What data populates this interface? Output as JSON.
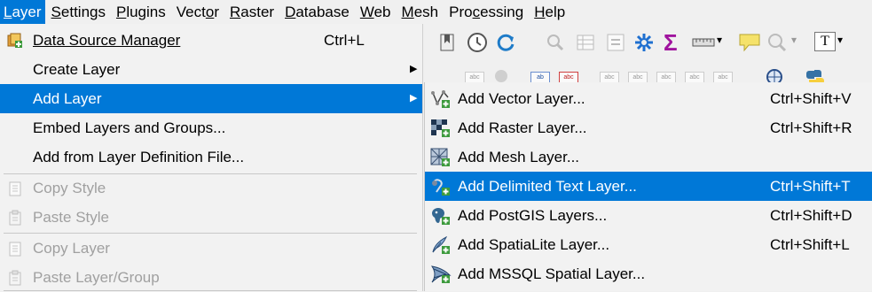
{
  "menubar": {
    "items": [
      {
        "mnemonic": "L",
        "rest": "ayer",
        "active": true
      },
      {
        "mnemonic": "S",
        "rest": "ettings",
        "active": false
      },
      {
        "mnemonic": "P",
        "rest": "lugins",
        "active": false
      },
      {
        "pre": "Vect",
        "mnemonic": "o",
        "rest": "r",
        "active": false
      },
      {
        "mnemonic": "R",
        "rest": "aster",
        "active": false
      },
      {
        "mnemonic": "D",
        "rest": "atabase",
        "active": false
      },
      {
        "mnemonic": "W",
        "rest": "eb",
        "active": false
      },
      {
        "mnemonic": "M",
        "rest": "esh",
        "active": false
      },
      {
        "pre": "Pro",
        "mnemonic": "c",
        "rest": "essing",
        "active": false
      },
      {
        "mnemonic": "H",
        "rest": "elp",
        "active": false
      }
    ]
  },
  "layer_menu": {
    "items": [
      {
        "label": "Data Source Manager",
        "shortcut": "Ctrl+L",
        "icon": "data-source-manager-icon"
      },
      {
        "label": "Create Layer",
        "submenu": true
      },
      {
        "label": "Add Layer",
        "submenu": true,
        "highlighted": true
      },
      {
        "label": "Embed Layers and Groups..."
      },
      {
        "label": "Add from Layer Definition File..."
      },
      {
        "label": "Copy Style",
        "disabled": true,
        "icon": "copy-style-icon"
      },
      {
        "label": "Paste Style",
        "disabled": true,
        "icon": "paste-style-icon"
      },
      {
        "label": "Copy Layer",
        "disabled": true,
        "icon": "copy-layer-icon"
      },
      {
        "label": "Paste Layer/Group",
        "disabled": true,
        "icon": "paste-layer-icon"
      }
    ],
    "arrow_glyph": "▶"
  },
  "add_layer_submenu": {
    "items": [
      {
        "label": "Add Vector Layer...",
        "shortcut": "Ctrl+Shift+V",
        "icon": "vector-layer-icon"
      },
      {
        "label": "Add Raster Layer...",
        "shortcut": "Ctrl+Shift+R",
        "icon": "raster-layer-icon"
      },
      {
        "label": "Add Mesh Layer...",
        "shortcut": "",
        "icon": "mesh-layer-icon"
      },
      {
        "label": "Add Delimited Text Layer...",
        "shortcut": "Ctrl+Shift+T",
        "icon": "delimited-text-icon",
        "highlighted": true
      },
      {
        "label": "Add PostGIS Layers...",
        "shortcut": "Ctrl+Shift+D",
        "icon": "postgis-icon"
      },
      {
        "label": "Add SpatiaLite Layer...",
        "shortcut": "Ctrl+Shift+L",
        "icon": "spatialite-icon"
      },
      {
        "label": "Add MSSQL Spatial Layer...",
        "shortcut": "",
        "icon": "mssql-icon"
      }
    ]
  },
  "toolbar": {
    "sigma_glyph": "Σ",
    "label_small": "abc",
    "label_ab": "ab",
    "text_tool_glyph": "T",
    "dropdown_glyph": "▾"
  },
  "colors": {
    "highlight": "#0078d7",
    "menu_bg": "#f2f2f2",
    "disabled_text": "#a0a0a0"
  }
}
